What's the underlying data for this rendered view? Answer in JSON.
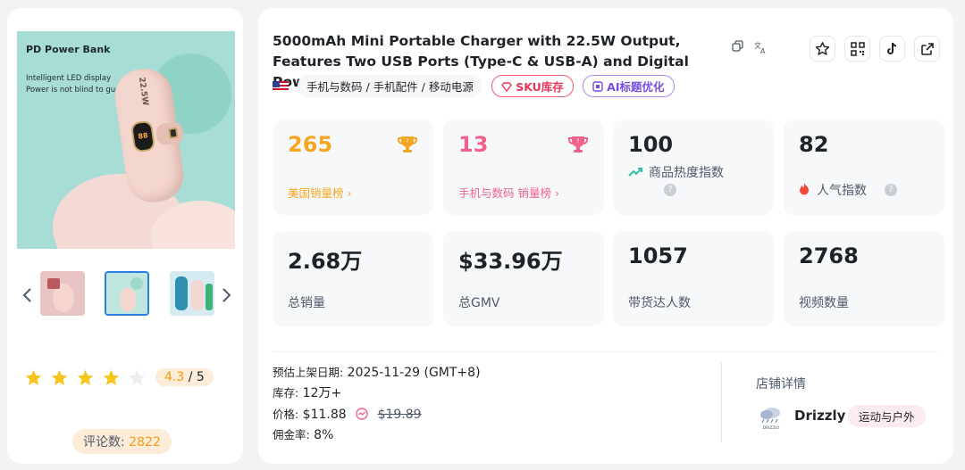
{
  "product": {
    "title": "5000mAh Mini Portable Charger with 22.5W Output, Features Two USB Ports (Type-C & USB-A) and Digital Power Display for...",
    "category_path": "手机与数码 / 手机配件 / 移动电源",
    "sku_tag": "SKU库存",
    "ai_tag": "AI标题优化",
    "image": {
      "headline": "PD Power Bank",
      "line1": "Intelligent LED display",
      "line2": "Power is not blind to guess",
      "device_text": "22.5W",
      "screen_value": "88"
    }
  },
  "rating": {
    "score": "4.3",
    "max": "5",
    "stars_filled": 4,
    "stars_total": 5,
    "review_label": "评论数:",
    "review_count": "2822"
  },
  "stats": {
    "us_rank": {
      "value": "265",
      "label": "美国销量榜"
    },
    "cat_rank": {
      "value": "13",
      "label": "手机与数码 销量榜"
    },
    "heat": {
      "value": "100",
      "label": "商品热度指数"
    },
    "popularity": {
      "value": "82",
      "label": "人气指数"
    },
    "total_sales": {
      "value": "2.68万",
      "label": "总销量"
    },
    "gmv": {
      "value": "$33.96万",
      "label": "总GMV"
    },
    "creators": {
      "value": "1057",
      "label": "带货达人数"
    },
    "videos": {
      "value": "2768",
      "label": "视频数量"
    }
  },
  "info": {
    "launch_label": "预估上架日期:",
    "launch_value": "2025-11-29 (GMT+8)",
    "stock_label": "库存:",
    "stock_value": "12万+",
    "price_label": "价格:",
    "price_value": "$11.88",
    "original_price": "$19.89",
    "commission_label": "佣金率:",
    "commission_value": "8%"
  },
  "shop": {
    "title": "店铺详情",
    "name": "Drizzly",
    "category": "运动与户外",
    "logo_text": "DRIZZLY"
  },
  "colors": {
    "orange": "#f5a623",
    "pink": "#f0628a",
    "teal": "#2fc2a6",
    "fire": "#f04a3a"
  },
  "icons": [
    "copy-icon",
    "translate-icon",
    "star-outline-icon",
    "qr-code-icon",
    "tiktok-icon",
    "external-link-icon",
    "trophy-icon",
    "trend-icon",
    "fire-icon",
    "help-icon",
    "price-trend-icon"
  ]
}
